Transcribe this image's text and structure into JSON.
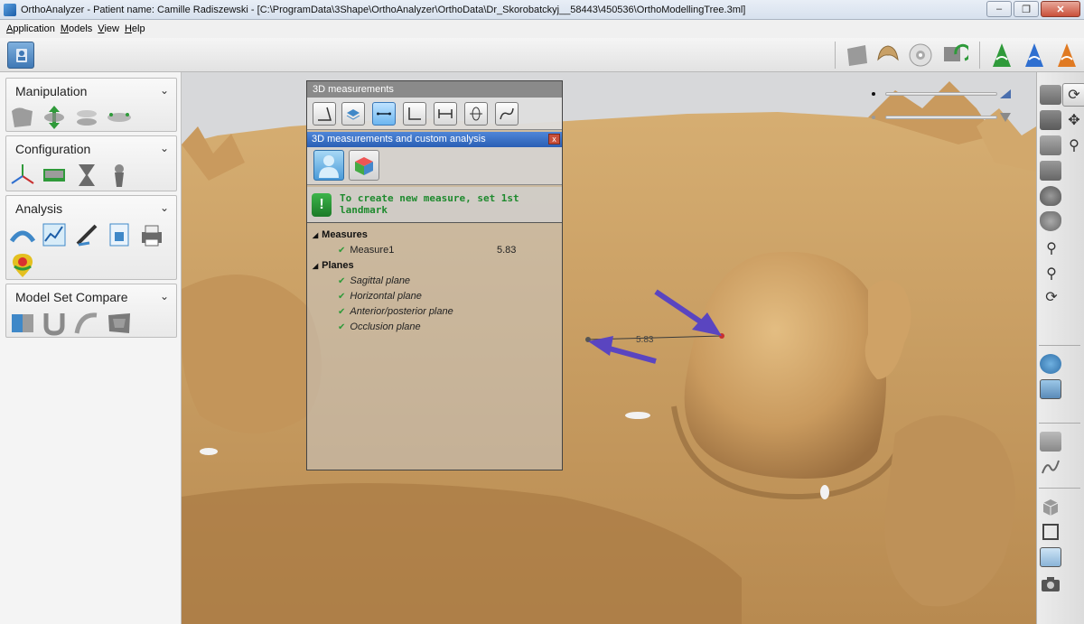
{
  "window": {
    "title": "OrthoAnalyzer - Patient name:  Camille Radiszewski  - [C:\\ProgramData\\3Shape\\OrthoAnalyzer\\OrthoData\\Dr_Skorobatckyj__58443\\450536\\OrthoModellingTree.3ml]",
    "controls": {
      "minimize": "–",
      "maximize": "❐",
      "close": "✕"
    }
  },
  "menu": {
    "items": [
      {
        "label": "Application",
        "mnemonic": "A",
        "rest": "pplication"
      },
      {
        "label": "Models",
        "mnemonic": "M",
        "rest": "odels"
      },
      {
        "label": "View",
        "mnemonic": "V",
        "rest": "iew"
      },
      {
        "label": "Help",
        "mnemonic": "H",
        "rest": "elp"
      }
    ]
  },
  "sidebar": {
    "sections": [
      {
        "title": "Manipulation",
        "icons": [
          "jaw-model-icon",
          "move-arrows-icon",
          "split-icon",
          "articulate-icon"
        ]
      },
      {
        "title": "Configuration",
        "icons": [
          "axis-icon",
          "base-icon",
          "hourglass-icon",
          "pin-icon"
        ]
      },
      {
        "title": "Analysis",
        "icons": [
          "arch-icon",
          "graph-icon",
          "ruler-icon",
          "report-icon",
          "printer-icon",
          "colormap-icon"
        ]
      },
      {
        "title": "Model Set Compare",
        "icons": [
          "compare-icon",
          "overlay-icon",
          "curve-icon",
          "surface-icon"
        ]
      }
    ],
    "chevron": "⌄"
  },
  "measure_panel": {
    "header": "3D measurements",
    "subheader": "3D measurements and custom analysis",
    "close": "x",
    "instruction": "To create new measure, set 1st landmark",
    "instruction_icon": "!",
    "groups": {
      "measures": {
        "label": "Measures",
        "items": [
          {
            "label": "Measure1",
            "value": "5.83"
          }
        ]
      },
      "planes": {
        "label": "Planes",
        "items": [
          {
            "label": "Sagittal plane"
          },
          {
            "label": "Horizontal plane"
          },
          {
            "label": "Anterior/posterior plane"
          },
          {
            "label": "Occlusion plane"
          }
        ]
      }
    },
    "check": "✔",
    "triangle": "◢"
  },
  "viewport": {
    "measure_label": "5.83",
    "model_color": "#c8a066",
    "arrow_color": "#5a45c0"
  },
  "right_toolbar": {
    "rotate": "⟳",
    "pan": "✥",
    "zoom": "⚲"
  }
}
